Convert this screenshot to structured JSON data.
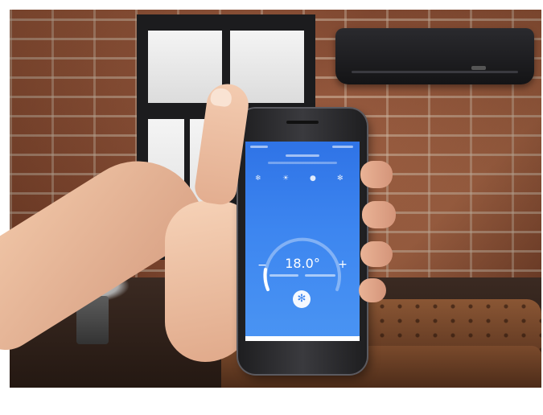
{
  "scene": {
    "phone_app": {
      "temperature": "18.0°",
      "minus_label": "−",
      "plus_label": "+",
      "fan_icon": "fan-icon",
      "mode_icons": [
        "snowflake-icon",
        "sun-icon",
        "drop-icon",
        "fan-icon"
      ]
    },
    "colors": {
      "screen_blue": "#3d86f0",
      "brick": "#8a4a30",
      "ac_unit": "#1f1f22"
    }
  }
}
